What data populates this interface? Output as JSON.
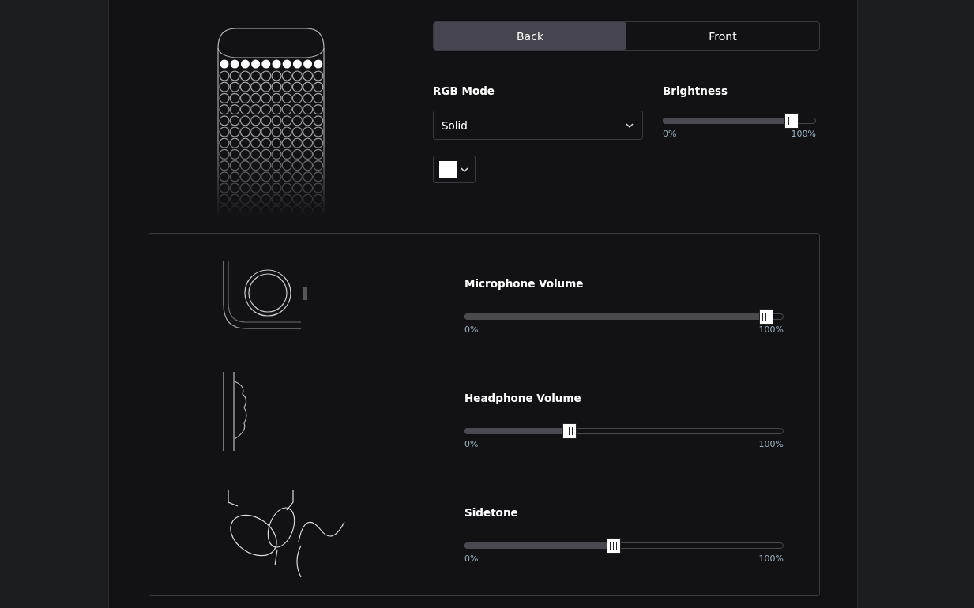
{
  "tabs": [
    {
      "label": "Back",
      "selected": true
    },
    {
      "label": "Front",
      "selected": false
    }
  ],
  "rgb_mode": {
    "label": "RGB Mode",
    "value": "Solid"
  },
  "color_picker": {
    "color": "#ffffff"
  },
  "brightness": {
    "label": "Brightness",
    "level": 0.85,
    "min_label": "0%",
    "max_label": "100%"
  },
  "audio": [
    {
      "kind": "microphone",
      "label": "Microphone Volume",
      "level": 0.95,
      "min_label": "0%",
      "max_label": "100%"
    },
    {
      "kind": "headphone",
      "label": "Headphone Volume",
      "level": 0.33,
      "min_label": "0%",
      "max_label": "100%"
    },
    {
      "kind": "sidetone",
      "label": "Sidetone",
      "level": 0.47,
      "min_label": "0%",
      "max_label": "100%"
    }
  ]
}
